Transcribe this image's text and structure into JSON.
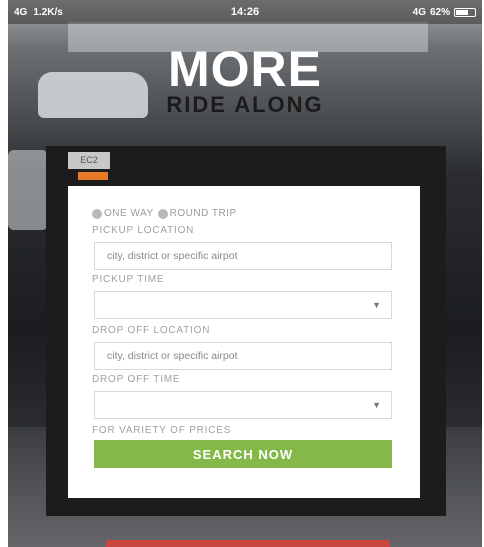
{
  "status_bar": {
    "network": "4G",
    "speed": "1.2K/s",
    "time": "14:26",
    "signal_right": "4G",
    "battery": "62%"
  },
  "hero": {
    "title": "MORE",
    "subtitle": "RIDE ALONG"
  },
  "tabs": {
    "first_label": "EC2"
  },
  "form": {
    "trip_options": [
      "ONE WAY",
      "ROUND TRIP"
    ],
    "pickup_location_label": "PICKUP LOCATION",
    "pickup_location_placeholder": "city, district or specific airpot",
    "pickup_time_label": "PICKUP TIME",
    "drop_location_label": "DROP OFF LOCATION",
    "drop_location_placeholder": "city, district or specific airpot",
    "drop_time_label": "DROP OFF TIME",
    "note": "FOR VARIETY OF PRICES",
    "search_label": "SEARCH NOW"
  },
  "colors": {
    "search_button": "#84b94a",
    "accent_tab": "#e8782a",
    "bottom_button": "#c9463f"
  },
  "icons": {
    "battery": "battery-icon",
    "dropdown": "chevron-down-icon",
    "radio": "radio-icon"
  }
}
